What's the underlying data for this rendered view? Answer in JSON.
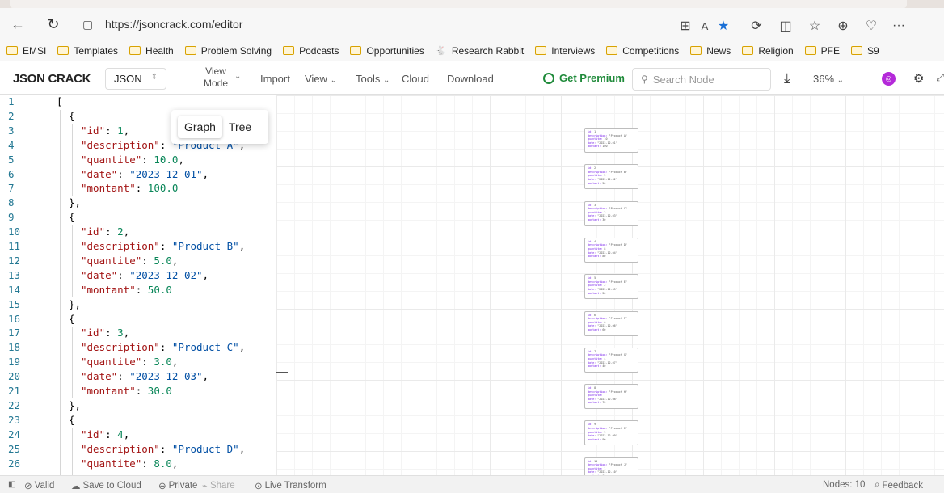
{
  "browser": {
    "url": "https://jsoncrack.com/editor",
    "bookmarks": [
      "EMSI",
      "Templates",
      "Health",
      "Problem Solving",
      "Podcasts",
      "Opportunities",
      "Research Rabbit",
      "Interviews",
      "Competitions",
      "News",
      "Religion",
      "PFE",
      "S9"
    ]
  },
  "toolbar": {
    "logo": "JSON CRACK",
    "format": "JSON",
    "view_mode_line1": "View",
    "view_mode_line2": "Mode",
    "import": "Import",
    "view": "View",
    "tools": "Tools",
    "cloud": "Cloud",
    "download": "Download",
    "premium": "Get Premium",
    "search_placeholder": "Search Node",
    "zoom": "36%"
  },
  "view_mode_options": [
    "Graph",
    "Tree"
  ],
  "editor_lines": [
    {
      "n": "1",
      "i": 0,
      "t": "["
    },
    {
      "n": "2",
      "i": 1,
      "t": "{"
    },
    {
      "n": "3",
      "i": 2,
      "k": "\"id\"",
      "v": "1",
      "vt": "n"
    },
    {
      "n": "4",
      "i": 2,
      "k": "\"description\"",
      "v": "\"Product A\"",
      "vt": "s"
    },
    {
      "n": "5",
      "i": 2,
      "k": "\"quantite\"",
      "v": "10.0",
      "vt": "n"
    },
    {
      "n": "6",
      "i": 2,
      "k": "\"date\"",
      "v": "\"2023-12-01\"",
      "vt": "s"
    },
    {
      "n": "7",
      "i": 2,
      "k": "\"montant\"",
      "v": "100.0",
      "vt": "n",
      "last": true
    },
    {
      "n": "8",
      "i": 1,
      "t": "},"
    },
    {
      "n": "9",
      "i": 1,
      "t": "{"
    },
    {
      "n": "10",
      "i": 2,
      "k": "\"id\"",
      "v": "2",
      "vt": "n"
    },
    {
      "n": "11",
      "i": 2,
      "k": "\"description\"",
      "v": "\"Product B\"",
      "vt": "s"
    },
    {
      "n": "12",
      "i": 2,
      "k": "\"quantite\"",
      "v": "5.0",
      "vt": "n"
    },
    {
      "n": "13",
      "i": 2,
      "k": "\"date\"",
      "v": "\"2023-12-02\"",
      "vt": "s"
    },
    {
      "n": "14",
      "i": 2,
      "k": "\"montant\"",
      "v": "50.0",
      "vt": "n",
      "last": true
    },
    {
      "n": "15",
      "i": 1,
      "t": "},"
    },
    {
      "n": "16",
      "i": 1,
      "t": "{"
    },
    {
      "n": "17",
      "i": 2,
      "k": "\"id\"",
      "v": "3",
      "vt": "n"
    },
    {
      "n": "18",
      "i": 2,
      "k": "\"description\"",
      "v": "\"Product C\"",
      "vt": "s"
    },
    {
      "n": "19",
      "i": 2,
      "k": "\"quantite\"",
      "v": "3.0",
      "vt": "n"
    },
    {
      "n": "20",
      "i": 2,
      "k": "\"date\"",
      "v": "\"2023-12-03\"",
      "vt": "s"
    },
    {
      "n": "21",
      "i": 2,
      "k": "\"montant\"",
      "v": "30.0",
      "vt": "n",
      "last": true
    },
    {
      "n": "22",
      "i": 1,
      "t": "},"
    },
    {
      "n": "23",
      "i": 1,
      "t": "{"
    },
    {
      "n": "24",
      "i": 2,
      "k": "\"id\"",
      "v": "4",
      "vt": "n"
    },
    {
      "n": "25",
      "i": 2,
      "k": "\"description\"",
      "v": "\"Product D\"",
      "vt": "s"
    },
    {
      "n": "26",
      "i": 2,
      "k": "\"quantite\"",
      "v": "8.0",
      "vt": "n"
    }
  ],
  "graph_nodes": [
    {
      "id": "1",
      "description": "\"Product A\"",
      "quantite": "10",
      "date": "\"2023-12-01\"",
      "montant": "100"
    },
    {
      "id": "2",
      "description": "\"Product B\"",
      "quantite": "5",
      "date": "\"2023-12-02\"",
      "montant": "50"
    },
    {
      "id": "3",
      "description": "\"Product C\"",
      "quantite": "3",
      "date": "\"2023-12-03\"",
      "montant": "30"
    },
    {
      "id": "4",
      "description": "\"Product D\"",
      "quantite": "8",
      "date": "\"2023-12-04\"",
      "montant": "80"
    },
    {
      "id": "5",
      "description": "\"Product E\"",
      "quantite": "2",
      "date": "\"2023-12-05\"",
      "montant": "20"
    },
    {
      "id": "6",
      "description": "\"Product F\"",
      "quantite": "6",
      "date": "\"2023-12-06\"",
      "montant": "60"
    },
    {
      "id": "7",
      "description": "\"Product G\"",
      "quantite": "4",
      "date": "\"2023-12-07\"",
      "montant": "40"
    },
    {
      "id": "8",
      "description": "\"Product H\"",
      "quantite": "7",
      "date": "\"2023-12-08\"",
      "montant": "70"
    },
    {
      "id": "9",
      "description": "\"Product I\"",
      "quantite": "9",
      "date": "\"2023-12-09\"",
      "montant": "90"
    },
    {
      "id": "10",
      "description": "\"Product J\"",
      "quantite": "1",
      "date": "\"2023-12-10\"",
      "montant": "10"
    }
  ],
  "footer": {
    "valid": "Valid",
    "save_cloud": "Save to Cloud",
    "private": "Private",
    "share": "Share",
    "live_transform": "Live Transform",
    "nodes": "Nodes: 10",
    "feedback": "Feedback"
  }
}
